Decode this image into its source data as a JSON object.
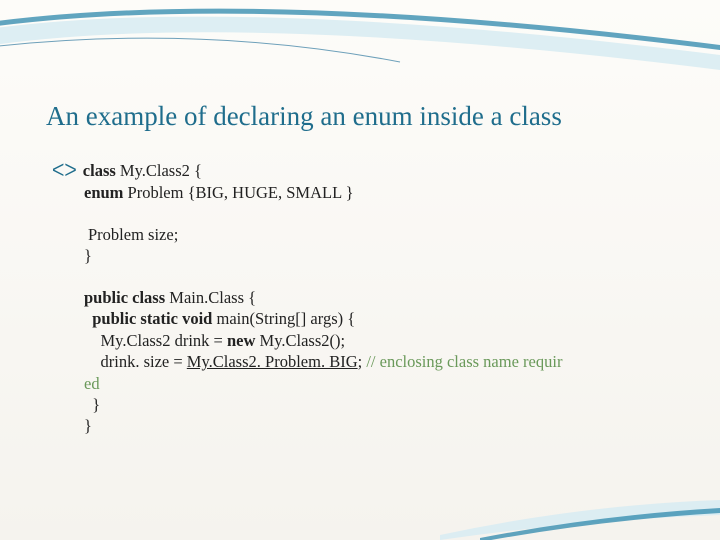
{
  "title": "An example of declaring an enum inside a class",
  "code": {
    "line1_kw": "class ",
    "line1_rest": "My.Class2 {",
    "line2_kw": "enum ",
    "line2_rest": "Problem {BIG, HUGE, SMALL }",
    "line3": "Problem size;",
    "line4": "}",
    "line5_pc": "public class ",
    "line5_rest": "Main.Class {",
    "line6_psv": "public static void ",
    "line6_rest": "main(String[] args) {",
    "line7_a": "My.Class2 drink = ",
    "line7_new": "new ",
    "line7_b": "My.Class2();",
    "line8_a": "drink. size = ",
    "line8_u": "My.Class2. Problem. BIG",
    "line8_b": ";   ",
    "line8_comment": "// enclosing class name requir",
    "line9": "ed",
    "line10": "}",
    "line11": "}"
  }
}
